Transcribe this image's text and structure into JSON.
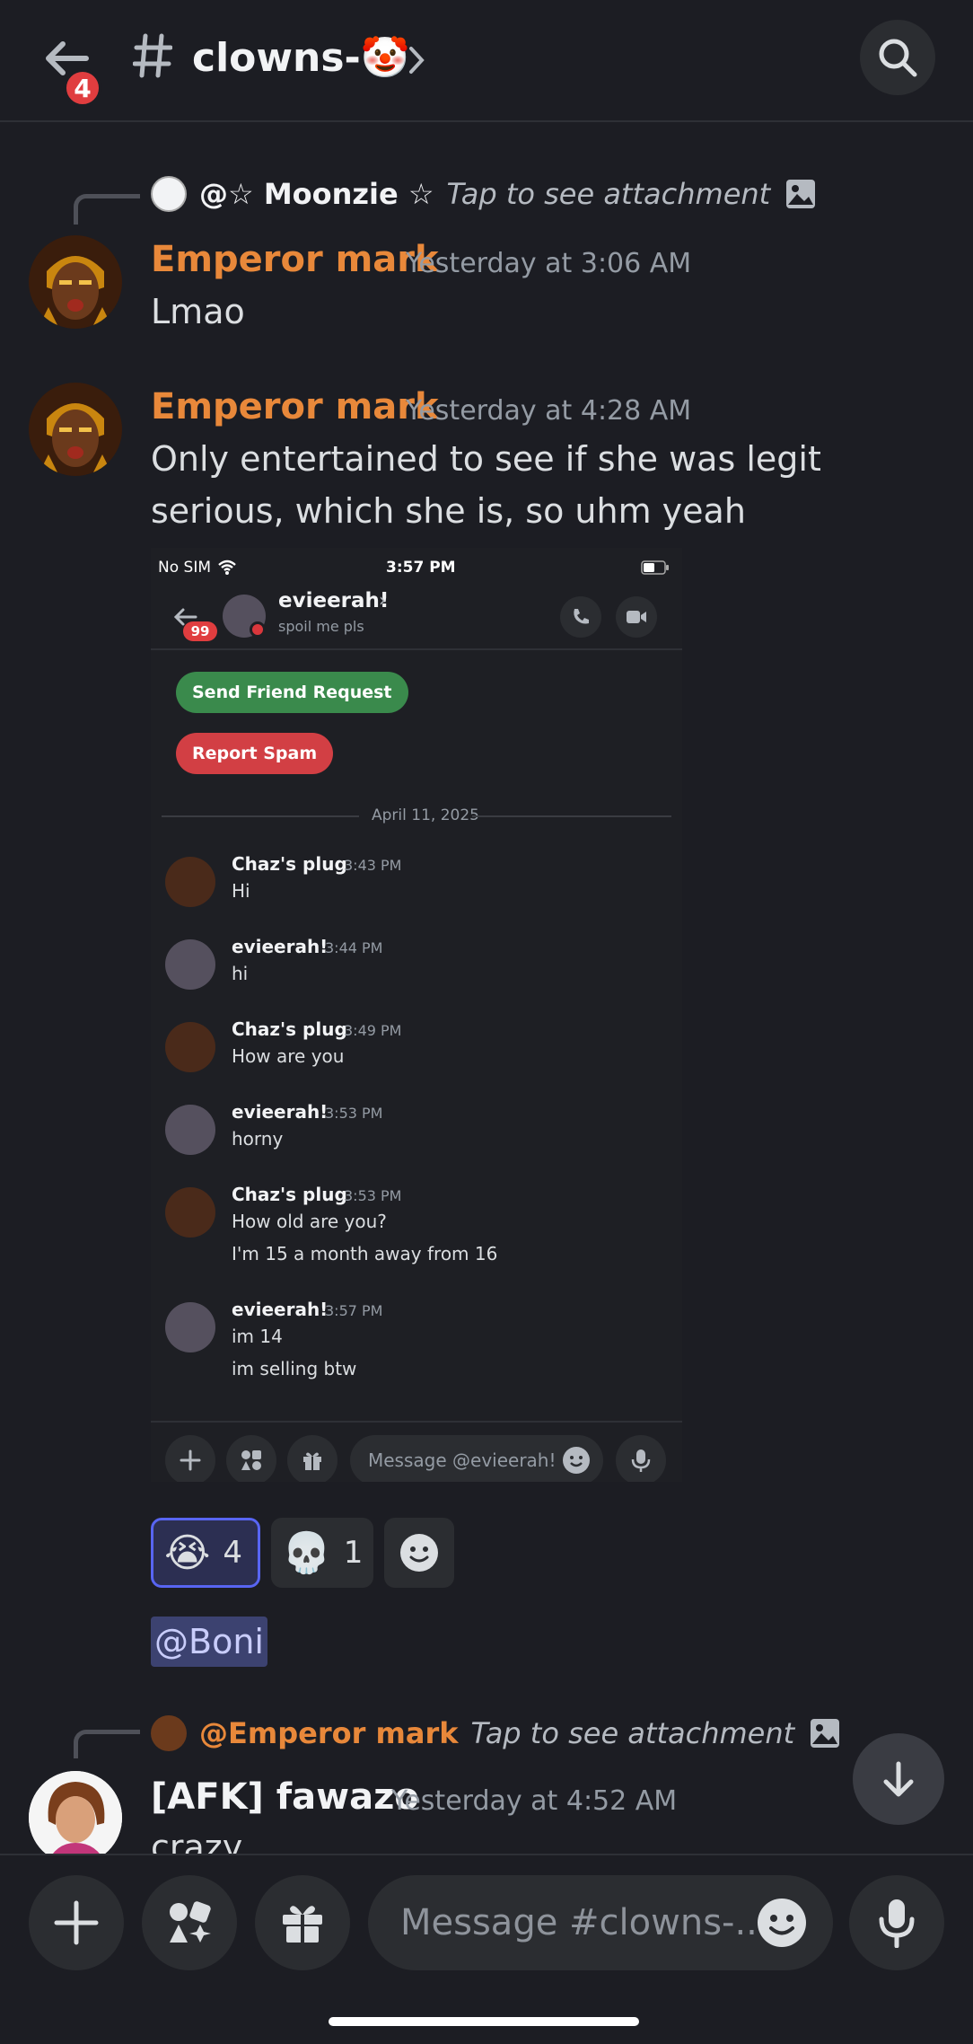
{
  "header": {
    "badge_count": "4",
    "channel_name": "clowns-🤡"
  },
  "messages": [
    {
      "reply": {
        "author": "@☆ 𝗠𝗼𝗼𝗻𝘇𝗶𝗲 ☆",
        "text": "Tap to see attachment"
      },
      "author": "Emperor mark",
      "timestamp": "Yesterday at 3:06 AM",
      "text": "Lmao"
    },
    {
      "author": "Emperor mark",
      "timestamp": "Yesterday at 4:28 AM",
      "text": "Only entertained to see if she was legit serious, which she is, so uhm yeah"
    }
  ],
  "attachment": {
    "status_carrier": "No SIM",
    "status_time": "3:57 PM",
    "badge": "99",
    "dm_name": "evieerah!",
    "dm_status": "spoil me pls",
    "friend_request": "Send Friend Request",
    "report_spam": "Report Spam",
    "date_divider": "April 11, 2025",
    "chat": [
      {
        "name": "Chaz's plug",
        "time": "3:43 PM",
        "lines": [
          "Hi"
        ]
      },
      {
        "name": "evieerah!",
        "time": "3:44 PM",
        "lines": [
          "hi"
        ]
      },
      {
        "name": "Chaz's plug",
        "time": "3:49 PM",
        "lines": [
          "How are you"
        ]
      },
      {
        "name": "evieerah!",
        "time": "3:53 PM",
        "lines": [
          "horny"
        ]
      },
      {
        "name": "Chaz's plug",
        "time": "3:53 PM",
        "lines": [
          "How old are you?",
          "I'm 15 a month away from 16"
        ]
      },
      {
        "name": "evieerah!",
        "time": "3:57 PM",
        "lines": [
          "im 14",
          "im selling btw"
        ]
      }
    ],
    "input_placeholder": "Message @evieerah!"
  },
  "reactions": [
    {
      "emoji": "😭",
      "count": "4"
    },
    {
      "emoji": "💀",
      "count": "1"
    }
  ],
  "mention": "@Boni",
  "third_message": {
    "reply": {
      "author": "@Emperor mark",
      "text": "Tap to see attachment"
    },
    "author": "[AFK] fawazo",
    "timestamp": "Yesterday at 4:52 AM",
    "text": "crazy"
  },
  "composer": {
    "placeholder": "Message #clowns-..."
  },
  "colors": {
    "emperor": "#e8883a",
    "accent": "#5865f2",
    "green": "#248046",
    "red": "#da373c"
  }
}
